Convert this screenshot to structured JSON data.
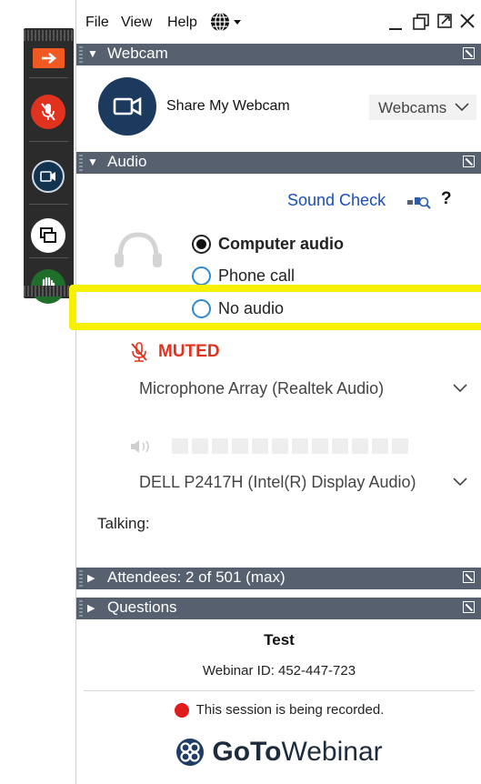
{
  "menu": {
    "file": "File",
    "view": "View",
    "help": "Help"
  },
  "webcam": {
    "header": "Webcam",
    "share_label": "Share My Webcam",
    "select_value": "Webcams"
  },
  "audio": {
    "header": "Audio",
    "sound_check": "Sound Check",
    "help_glyph": "?",
    "options": [
      {
        "label": "Computer audio",
        "selected": true
      },
      {
        "label": "Phone call",
        "selected": false
      },
      {
        "label": "No audio",
        "selected": false
      }
    ],
    "muted_label": "MUTED",
    "mic_device": "Microphone Array (Realtek Audio)",
    "speaker_device": "DELL P2417H (Intel(R) Display Audio)",
    "talking_label": "Talking:",
    "speaker_level_bars": 12
  },
  "attendees": {
    "header": "Attendees:  2 of 501 (max)"
  },
  "questions": {
    "header": "Questions"
  },
  "footer": {
    "title": "Test",
    "webinar_id": "Webinar ID: 452-447-723",
    "recording": "This session is being recorded.",
    "brand_goto": "GoTo",
    "brand_webinar": "Webinar"
  },
  "colors": {
    "header_bg": "#56606e",
    "accent_blue": "#1a4fb8",
    "muted_red": "#e0321f",
    "highlight": "#f7f000",
    "record_red": "#e01b1b"
  },
  "icons": [
    "globe-icon",
    "minimize-icon",
    "restore-icon",
    "popout-icon",
    "close-icon",
    "webcam-icon",
    "headset-icon",
    "muted-mic-icon",
    "speaker-icon",
    "chevron-down-icon",
    "sound-check-icon",
    "help-icon",
    "record-dot-icon",
    "gotowebinar-logo-icon"
  ]
}
